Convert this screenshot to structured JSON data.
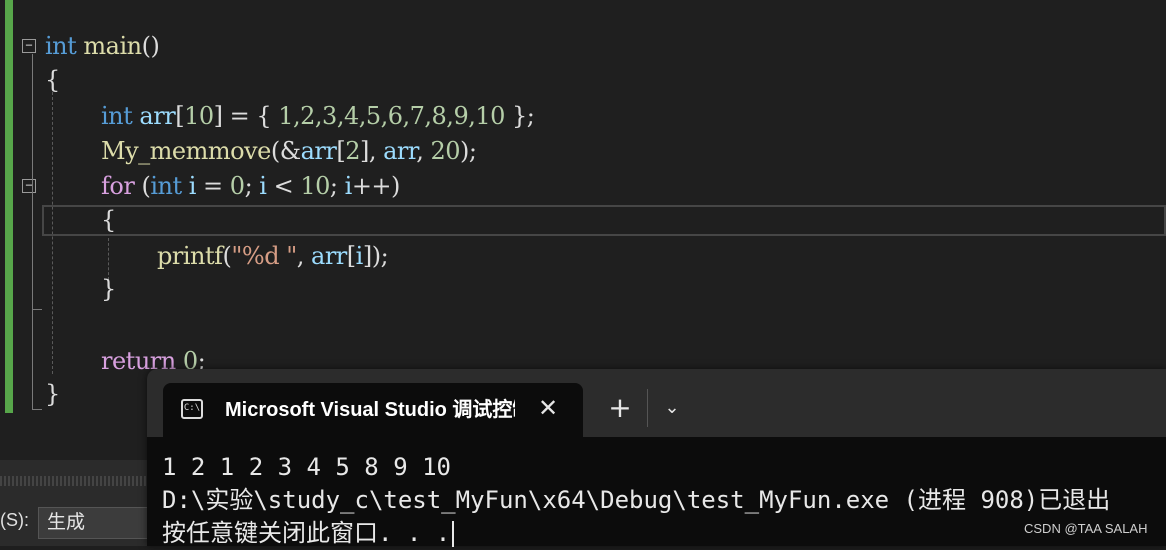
{
  "editor": {
    "line1": {
      "kw": "int",
      "fn": "main",
      "rest": "()"
    },
    "line2": "{",
    "line3": {
      "kw": "int",
      "id": "arr",
      "open": "[",
      "size": "10",
      "mid": "] = { ",
      "values": "1,2,3,4,5,6,7,8,9,10",
      "close": " };"
    },
    "line4": {
      "fn": "My_memmove",
      "a": "(&",
      "id1": "arr",
      "b": "[",
      "n1": "2",
      "c": "], ",
      "id2": "arr",
      "d": ", ",
      "n2": "20",
      "e": ");"
    },
    "line5": {
      "kw": "for",
      "a": " (",
      "kw2": "int",
      "b": " ",
      "id1": "i",
      "c": " = ",
      "n1": "0",
      "d": "; ",
      "id2": "i",
      "e": " < ",
      "n2": "10",
      "f": "; ",
      "id3": "i",
      "g": "++)"
    },
    "line6": "{",
    "line7": {
      "fn": "printf",
      "a": "(",
      "str": "\"%d \"",
      "b": ", ",
      "id1": "arr",
      "c": "[",
      "id2": "i",
      "d": "]);"
    },
    "line8": "}",
    "line9": {
      "kw": "return",
      "rest": " ",
      "num": "0",
      "end": ";"
    },
    "line10": "}"
  },
  "output_pane": {
    "show_label": "(S):",
    "show_value": "生成"
  },
  "terminal": {
    "tab_title": "Microsoft Visual Studio 调试控制台",
    "tab_icon": "C:\\",
    "close_glyph": "✕",
    "new_tab_glyph": "+",
    "dropdown_glyph": "⌄",
    "output_lines": [
      "1 2 1 2 3 4 5 8 9 10",
      "D:\\实验\\study_c\\test_MyFun\\x64\\Debug\\test_MyFun.exe (进程 908)已退出",
      "按任意键关闭此窗口. . ."
    ]
  },
  "watermark": "CSDN @TAA SALAH",
  "colors": {
    "keyword": "#569cd6",
    "function": "#dcdcaa",
    "identifier": "#9cdcfe",
    "number": "#b5cea8",
    "string": "#d69d85",
    "control": "#d8a0df",
    "change_bar": "#57a64a"
  }
}
